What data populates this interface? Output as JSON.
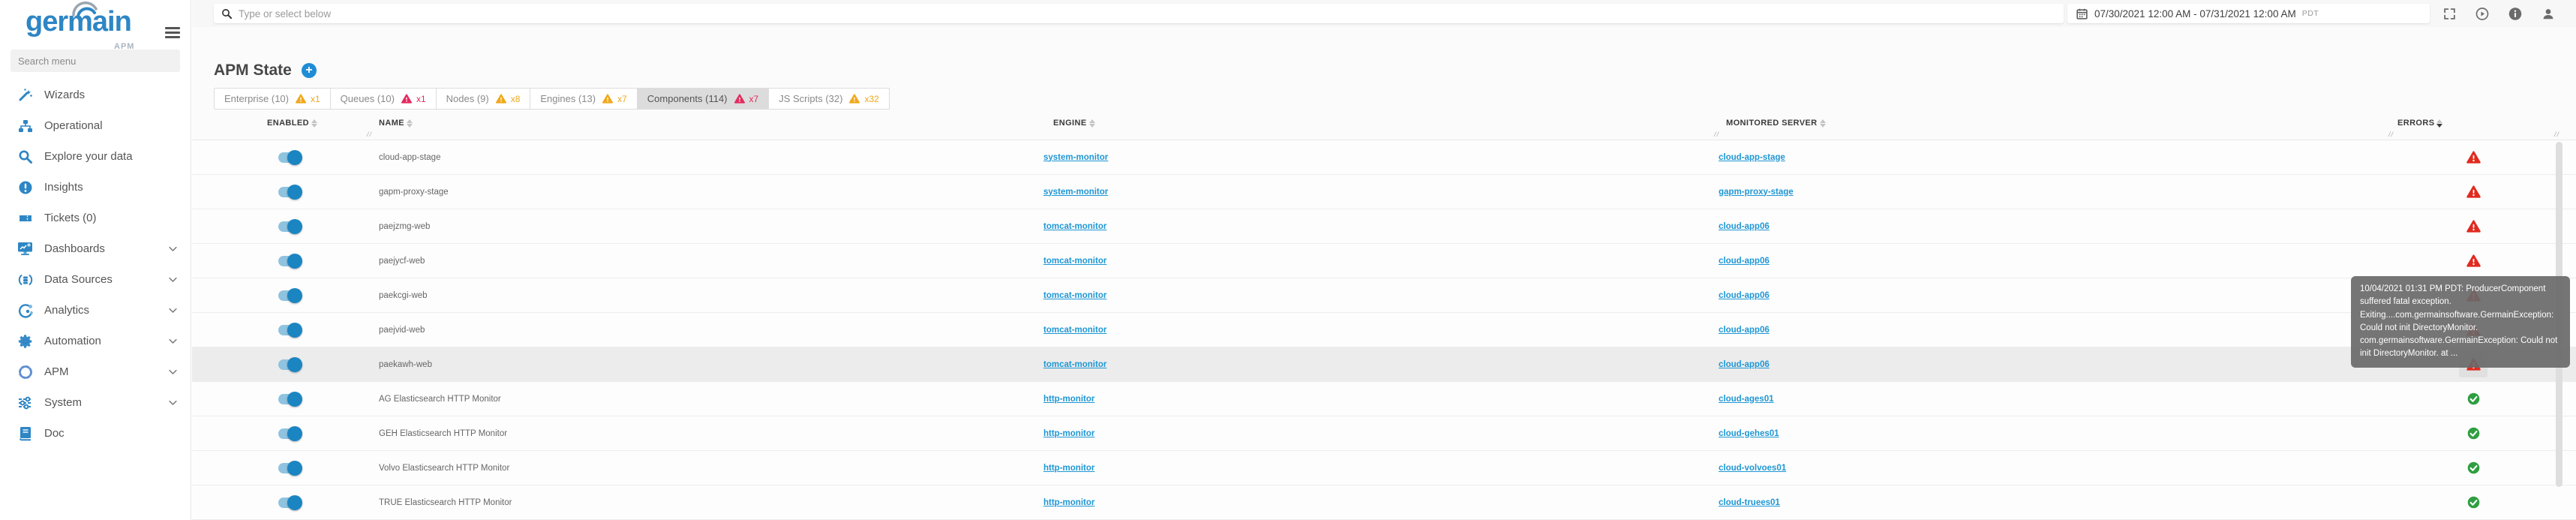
{
  "sidebar": {
    "brand": "germain",
    "brand_sub": "APM",
    "search_placeholder": "Search menu",
    "items": [
      {
        "label": "Wizards",
        "icon": "wand-icon",
        "expandable": false
      },
      {
        "label": "Operational",
        "icon": "sitemap-icon",
        "expandable": false
      },
      {
        "label": "Explore your data",
        "icon": "search-icon",
        "expandable": false
      },
      {
        "label": "Insights",
        "icon": "alert-circle-icon",
        "expandable": false
      },
      {
        "label": "Tickets (0)",
        "icon": "ticket-icon",
        "expandable": false
      },
      {
        "label": "Dashboards",
        "icon": "dashboard-icon",
        "expandable": true
      },
      {
        "label": "Data Sources",
        "icon": "database-icon",
        "expandable": true
      },
      {
        "label": "Analytics",
        "icon": "analytics-icon",
        "expandable": true
      },
      {
        "label": "Automation",
        "icon": "gear-icon",
        "expandable": true
      },
      {
        "label": "APM",
        "icon": "dashed-circle-icon",
        "expandable": true
      },
      {
        "label": "System",
        "icon": "sliders-icon",
        "expandable": true
      },
      {
        "label": "Doc",
        "icon": "book-icon",
        "expandable": false
      }
    ]
  },
  "topbar": {
    "search_placeholder": "Type or select below",
    "date_range": "07/30/2021 12:00 AM - 07/31/2021 12:00 AM",
    "timezone": "PDT"
  },
  "page": {
    "title": "APM State",
    "add_label": "+"
  },
  "tabs": [
    {
      "label": "Enterprise (10)",
      "badge": "x1",
      "severity": "warning",
      "active": false
    },
    {
      "label": "Queues (10)",
      "badge": "x1",
      "severity": "critical",
      "active": false
    },
    {
      "label": "Nodes (9)",
      "badge": "x8",
      "severity": "warning",
      "active": false
    },
    {
      "label": "Engines (13)",
      "badge": "x7",
      "severity": "warning",
      "active": false
    },
    {
      "label": "Components (114)",
      "badge": "x7",
      "severity": "critical",
      "active": true
    },
    {
      "label": "JS Scripts (32)",
      "badge": "x32",
      "severity": "warning",
      "active": false
    }
  ],
  "table": {
    "columns": {
      "enabled": "ENABLED",
      "name": "NAME",
      "engine": "ENGINE",
      "server": "MONITORED SERVER",
      "errors": "ERRORS"
    },
    "rows": [
      {
        "enabled": true,
        "name": "cloud-app-stage",
        "engine": "system-monitor",
        "server": "cloud-app-stage",
        "status": "error",
        "highlighted": false
      },
      {
        "enabled": true,
        "name": "gapm-proxy-stage",
        "engine": "system-monitor",
        "server": "gapm-proxy-stage",
        "status": "error",
        "highlighted": false
      },
      {
        "enabled": true,
        "name": "paejzmg-web",
        "engine": "tomcat-monitor",
        "server": "cloud-app06",
        "status": "error",
        "highlighted": false
      },
      {
        "enabled": true,
        "name": "paejycf-web",
        "engine": "tomcat-monitor",
        "server": "cloud-app06",
        "status": "error",
        "highlighted": false
      },
      {
        "enabled": true,
        "name": "paekcgi-web",
        "engine": "tomcat-monitor",
        "server": "cloud-app06",
        "status": "error",
        "highlighted": false
      },
      {
        "enabled": true,
        "name": "paejvid-web",
        "engine": "tomcat-monitor",
        "server": "cloud-app06",
        "status": "error",
        "highlighted": false
      },
      {
        "enabled": true,
        "name": "paekawh-web",
        "engine": "tomcat-monitor",
        "server": "cloud-app06",
        "status": "error",
        "highlighted": true
      },
      {
        "enabled": true,
        "name": "AG Elasticsearch HTTP Monitor",
        "engine": "http-monitor",
        "server": "cloud-ages01",
        "status": "ok",
        "highlighted": false
      },
      {
        "enabled": true,
        "name": "GEH Elasticsearch HTTP Monitor",
        "engine": "http-monitor",
        "server": "cloud-gehes01",
        "status": "ok",
        "highlighted": false
      },
      {
        "enabled": true,
        "name": "Volvo Elasticsearch HTTP Monitor",
        "engine": "http-monitor",
        "server": "cloud-volvoes01",
        "status": "ok",
        "highlighted": false
      },
      {
        "enabled": true,
        "name": "TRUE Elasticsearch HTTP Monitor",
        "engine": "http-monitor",
        "server": "cloud-truees01",
        "status": "ok",
        "highlighted": false
      }
    ]
  },
  "tooltip": {
    "text": "10/04/2021 01:31 PM PDT: ProducerComponent suffered fatal exception. Exiting....com.germainsoftware.GermainException: Could not init DirectoryMonitor. com.germainsoftware.GermainException: Could not init DirectoryMonitor. at ..."
  },
  "colors": {
    "accent_blue": "#1f8dd6",
    "link_blue": "#1f97d4",
    "warning_amber": "#f0a81c",
    "critical_crimson": "#e32b5e",
    "row_error_red": "#e02b20",
    "ok_green": "#2f9e41"
  }
}
